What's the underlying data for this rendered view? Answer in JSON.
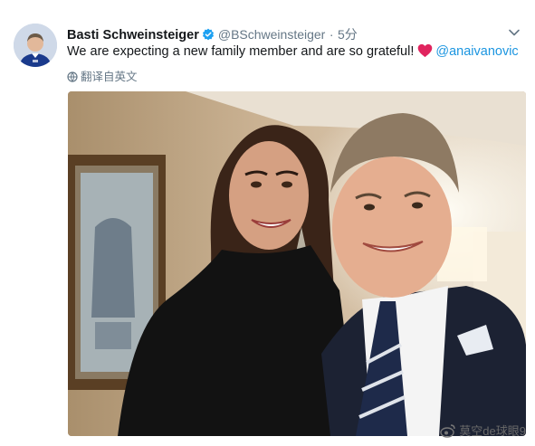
{
  "tweet": {
    "display_name": "Basti Schweinsteiger",
    "handle": "@BSchweinsteiger",
    "separator": "·",
    "time": "5分",
    "text": "We are expecting a new family member and are so grateful!",
    "mention": "@anaivanovic",
    "translate_label": "翻译自英文",
    "accent_color": "#1b95e0"
  },
  "icons": {
    "verified": "verified-badge-icon",
    "heart": "heart-icon",
    "caret": "chevron-down-icon",
    "translate": "globe-icon",
    "watermark": "weibo-logo-icon"
  },
  "watermark": {
    "text": "莫空de球眼9"
  }
}
